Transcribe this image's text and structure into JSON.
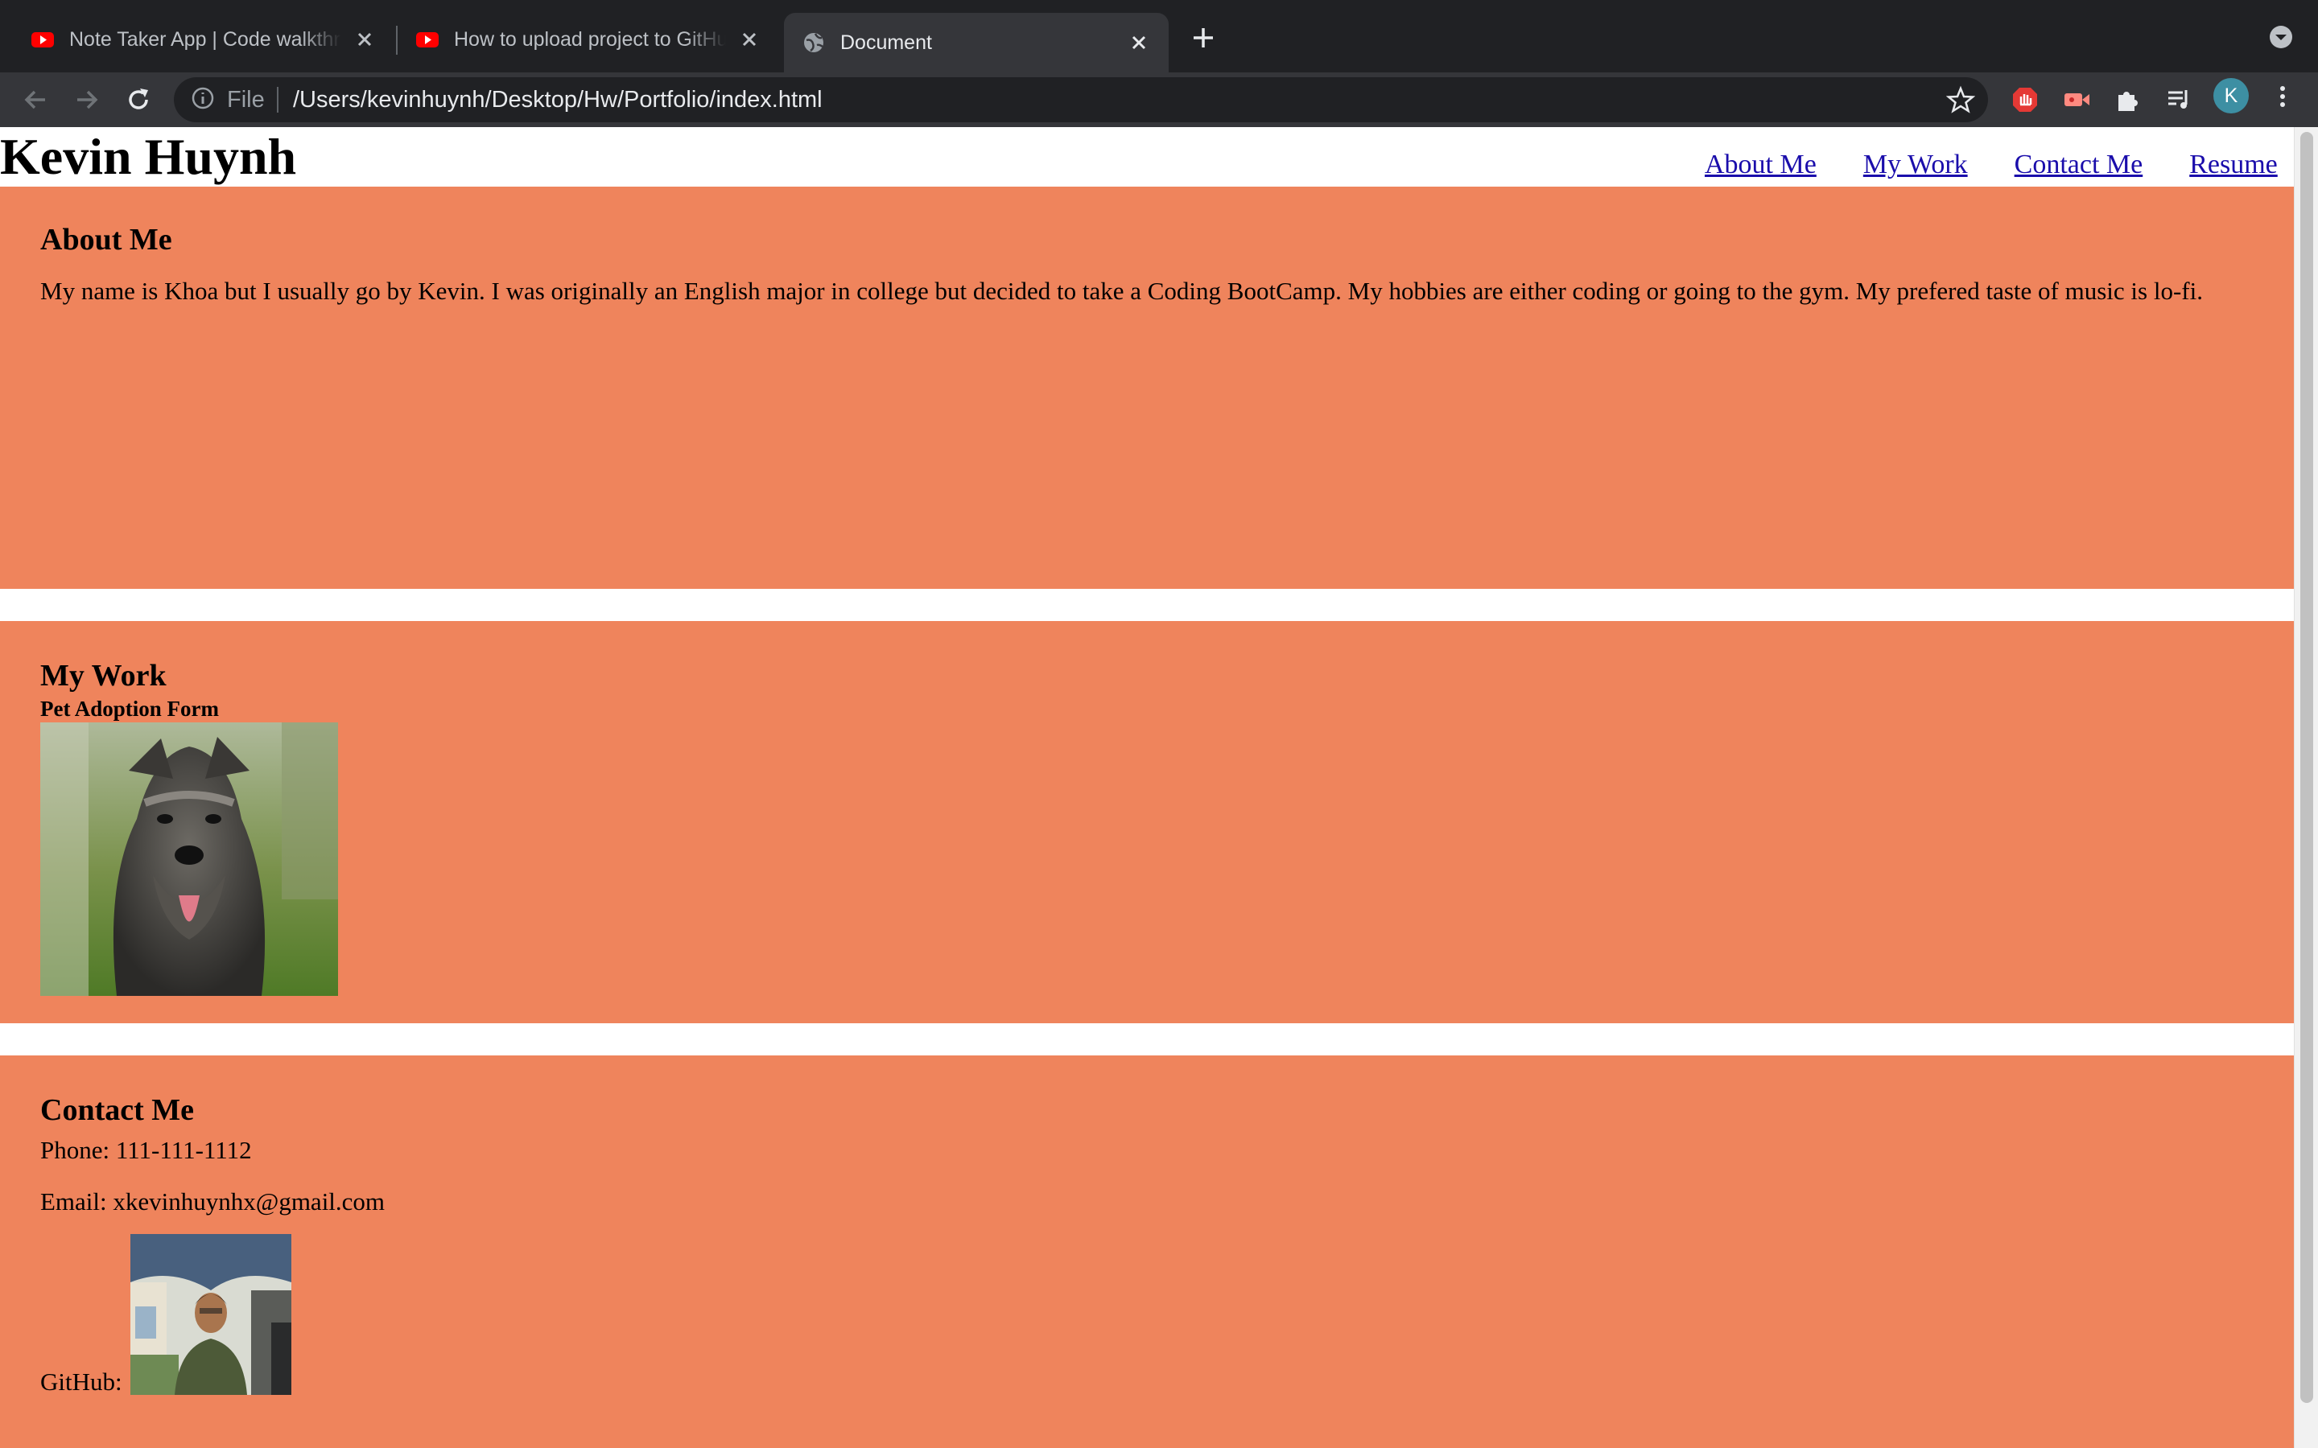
{
  "browser": {
    "tabs": [
      {
        "title": "Note Taker App | Code walkthrough",
        "icon": "youtube-icon"
      },
      {
        "title": "How to upload project to GitHub",
        "icon": "youtube-icon"
      },
      {
        "title": "Document",
        "icon": "globe-icon"
      }
    ],
    "address": {
      "scheme_label": "File",
      "url": "/Users/kevinhuynh/Desktop/Hw/Portfolio/index.html"
    },
    "profile_initial": "K",
    "colors": {
      "tabstrip": "#202124",
      "toolbar": "#35363a",
      "youtube_red": "#ff0000"
    }
  },
  "page": {
    "site_name": "Kevin Huynh",
    "nav": [
      "About Me",
      "My Work",
      "Contact Me",
      "Resume"
    ],
    "about": {
      "title": "About Me",
      "text": "My name is Khoa but I usually go by Kevin. I was originally an English major in college but decided to take a Coding BootCamp. My hobbies are either coding or going to the gym. My prefered taste of music is lo-fi."
    },
    "work": {
      "title": "My Work",
      "project_title": "Pet Adoption Form",
      "project_image": "schnauzer-dog-photo"
    },
    "contact": {
      "title": "Contact Me",
      "phone": "Phone: 111-111-1112",
      "email": "Email: xkevinhuynhx@gmail.com",
      "github_label": "GitHub:",
      "github_image": "profile-photo"
    },
    "colors": {
      "section_bg": "#ef845c",
      "link": "#1a0dab"
    }
  }
}
